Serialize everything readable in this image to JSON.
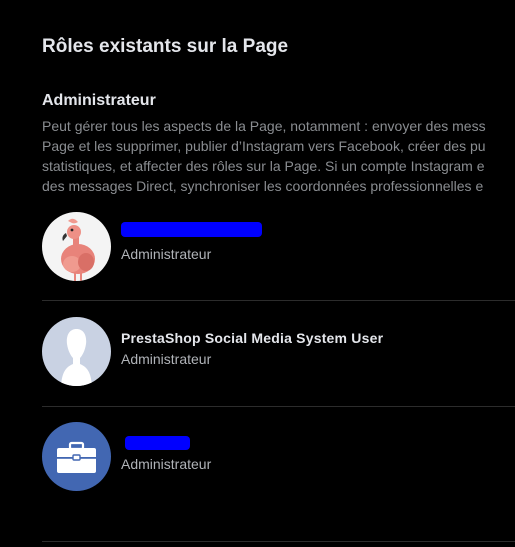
{
  "page_title": "Rôles existants sur la Page",
  "section": {
    "title": "Administrateur",
    "description_lines": [
      "Peut gérer tous les aspects de la Page, notamment : envoyer des mess",
      "Page et les supprimer, publier d’Instagram vers Facebook, créer des pu",
      "statistiques, et affecter des rôles sur la Page. Si un compte Instagram e",
      "des messages Direct, synchroniser les coordonnées professionnelles e"
    ]
  },
  "members": [
    {
      "name": "",
      "name_redacted": true,
      "role": "Administrateur",
      "avatar_icon": "flamingo-photo-icon"
    },
    {
      "name": "PrestaShop Social Media System User",
      "name_redacted": false,
      "role": "Administrateur",
      "avatar_icon": "default-user-silhouette-icon"
    },
    {
      "name": "",
      "name_redacted": true,
      "role": "Administrateur",
      "avatar_icon": "briefcase-icon"
    }
  ],
  "colors": {
    "background": "#000000",
    "redaction": "#0000ff",
    "business_avatar": "#4267b2"
  }
}
